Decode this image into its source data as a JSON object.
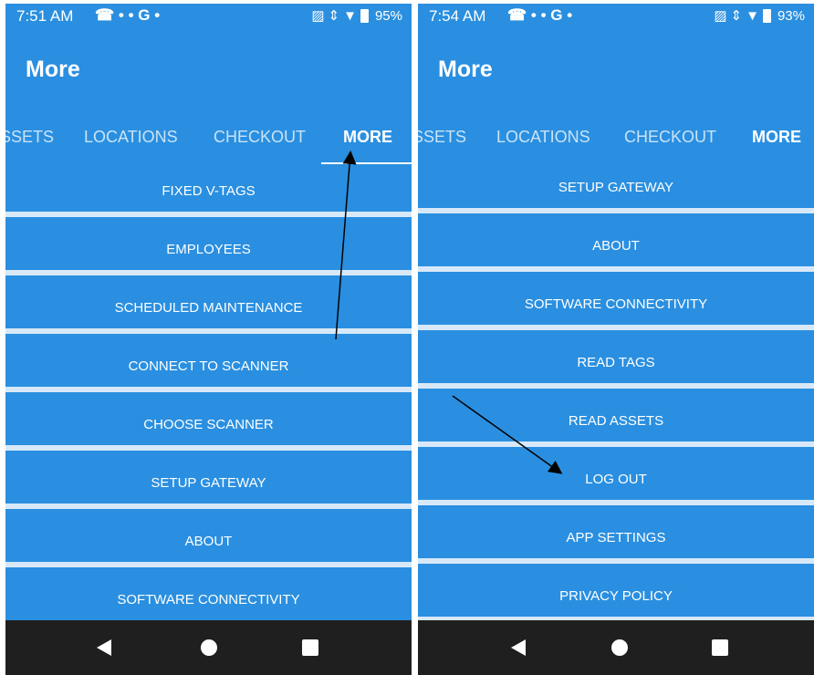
{
  "left": {
    "status": {
      "time": "7:51 AM",
      "left_icons": "☎ • • G •",
      "battery": "95%"
    },
    "title": "More",
    "tabs": [
      "SSETS",
      "LOCATIONS",
      "CHECKOUT",
      "MORE"
    ],
    "menu": [
      "FIXED V-TAGS",
      "EMPLOYEES",
      "SCHEDULED MAINTENANCE",
      "CONNECT TO SCANNER",
      "CHOOSE SCANNER",
      "SETUP GATEWAY",
      "ABOUT",
      "SOFTWARE CONNECTIVITY"
    ]
  },
  "right": {
    "status": {
      "time": "7:54 AM",
      "left_icons": "☎ • • G •",
      "battery": "93%"
    },
    "title": "More",
    "tabs": [
      "SSETS",
      "LOCATIONS",
      "CHECKOUT",
      "MORE"
    ],
    "menu": [
      "SETUP GATEWAY",
      "ABOUT",
      "SOFTWARE CONNECTIVITY",
      "READ TAGS",
      "READ ASSETS",
      "LOG OUT",
      "APP SETTINGS",
      "PRIVACY POLICY"
    ]
  },
  "icons": {
    "status_right": [
      "cast-icon",
      "data-arrows-icon",
      "wifi-icon",
      "battery-icon"
    ],
    "nav": [
      "back-icon",
      "home-icon",
      "recent-apps-icon"
    ]
  },
  "colors": {
    "primary": "#2a8fe0",
    "divider": "#d7e9f8",
    "navbar": "#1f1f1f",
    "annotation": "#000000"
  }
}
